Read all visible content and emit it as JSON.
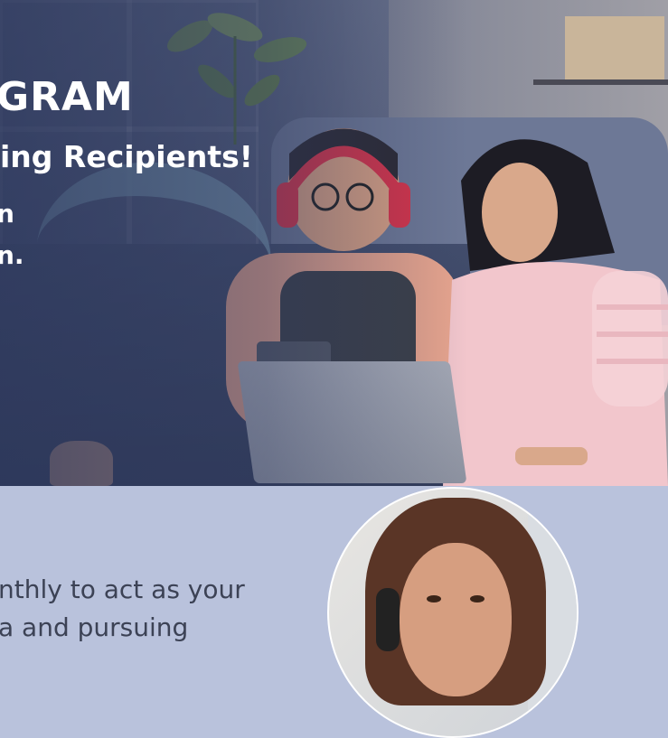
{
  "hero": {
    "title": "GRAM",
    "subtitle": "ing Recipients!",
    "line3": "n",
    "line4": "n."
  },
  "lower": {
    "line1": "nthly to act as your",
    "line2": "a and pursuing"
  },
  "colors": {
    "hero_overlay": "#2c375c",
    "lower_bg": "#b9c2dc",
    "lower_text": "#3c4255",
    "accent_swoosh": "#7fa2b8",
    "headphones": "#d8344a"
  }
}
